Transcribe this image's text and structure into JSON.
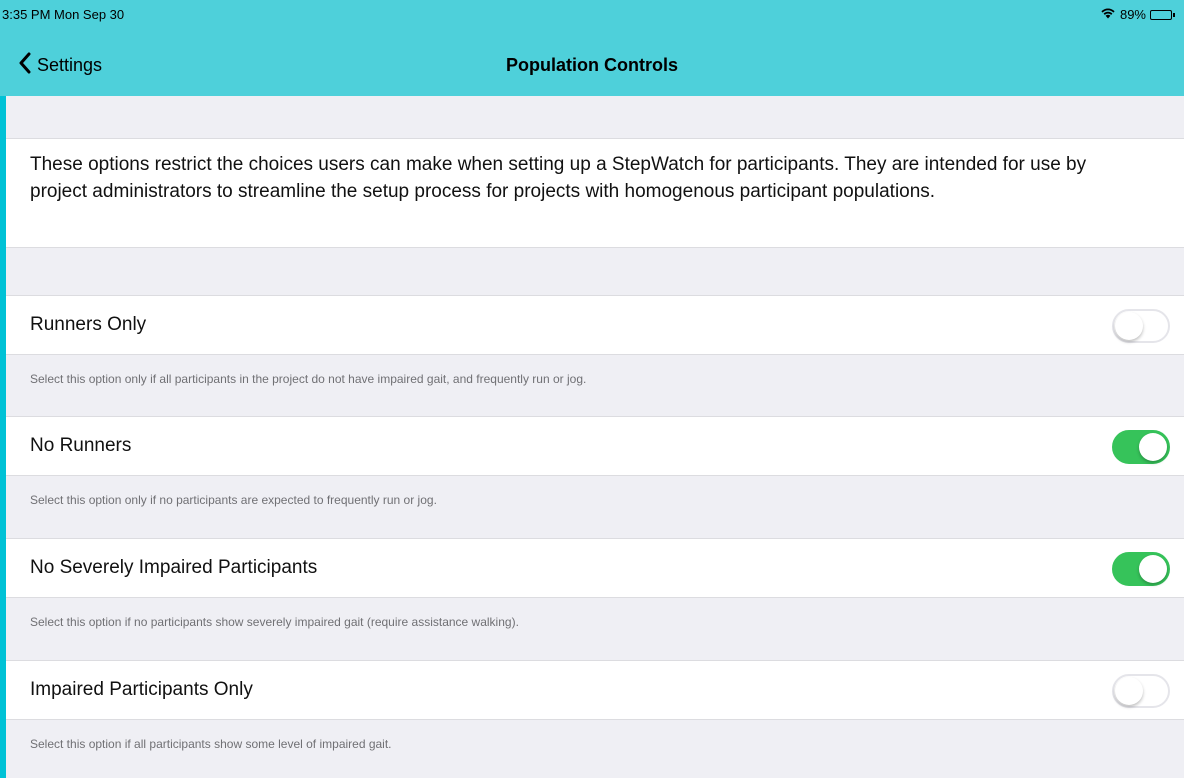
{
  "status_bar": {
    "time": "3:35 PM  Mon Sep 30",
    "battery": "89%",
    "battery_level": 0.89
  },
  "nav": {
    "back_label": "Settings",
    "title": "Population Controls"
  },
  "description": "These options restrict the choices users can make when setting up a StepWatch for participants. They are intended for use by project administrators to streamline the setup process for projects with homogenous participant populations.",
  "options": [
    {
      "label": "Runners Only",
      "enabled": false,
      "footer": "Select this option only if all participants in the project do not have impaired gait, and frequently run or jog."
    },
    {
      "label": "No Runners",
      "enabled": true,
      "footer": "Select this option only if no participants are expected to frequently run or jog."
    },
    {
      "label": "No Severely Impaired Participants",
      "enabled": true,
      "footer": "Select this option if no participants show severely impaired gait (require assistance walking)."
    },
    {
      "label": "Impaired Participants Only",
      "enabled": false,
      "footer": "Select this option if all participants show some level of impaired gait."
    }
  ],
  "colors": {
    "header": "#4ed0da",
    "toggle_on": "#36c35a",
    "background": "#efeff4"
  },
  "icons": {
    "back": "chevron-left-icon",
    "wifi": "wifi-icon",
    "battery": "battery-icon"
  }
}
